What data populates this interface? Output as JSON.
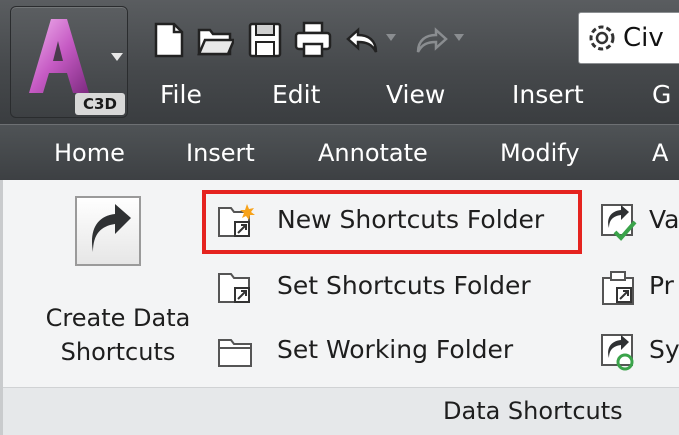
{
  "app": {
    "badge": "C3D",
    "workspace_text": "Civ"
  },
  "menubar": {
    "items": [
      "File",
      "Edit",
      "View",
      "Insert",
      "G"
    ]
  },
  "ribbon": {
    "tabs": [
      "Home",
      "Insert",
      "Annotate",
      "Modify",
      "A"
    ],
    "panel": {
      "big_button": {
        "line1": "Create Data",
        "line2": "Shortcuts"
      },
      "commands": [
        {
          "label": "New Shortcuts Folder",
          "icon": "new-folder-icon",
          "highlighted": true
        },
        {
          "label": "Set Shortcuts Folder",
          "icon": "set-folder-icon"
        },
        {
          "label": "Set Working Folder",
          "icon": "folder-icon"
        }
      ],
      "right_commands": [
        {
          "label": "Va",
          "icon": "validate-icon"
        },
        {
          "label": "Pr",
          "icon": "promote-icon"
        },
        {
          "label": "Sy",
          "icon": "sync-icon"
        }
      ],
      "title": "Data Shortcuts"
    }
  },
  "colors": {
    "highlight": "#e5231f",
    "titlebar": "#46494c",
    "panel": "#f3f4f5"
  }
}
